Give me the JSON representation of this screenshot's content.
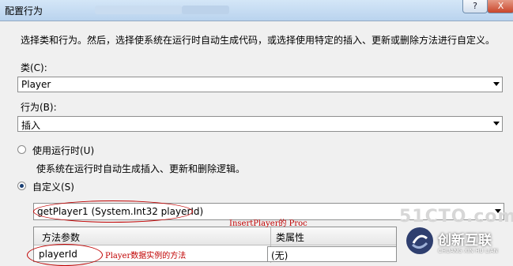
{
  "window": {
    "title": "配置行为",
    "minimize_label": "?",
    "close_label": "X"
  },
  "description": "选择类和行为。然后，选择使系统在运行时自动生成代码，或选择使用特定的插入、更新或删除方法进行自定义。",
  "class_field": {
    "label": "类(C):",
    "value": "Player"
  },
  "behavior_field": {
    "label": "行为(B):",
    "value": "插入"
  },
  "runtime_option": {
    "label": "使用运行时(U)",
    "description": "使系统在运行时自动生成插入、更新和删除逻辑。",
    "checked": false
  },
  "custom_option": {
    "label": "自定义(S)",
    "checked": true
  },
  "method_field": {
    "value": "getPlayer1 (System.Int32 playerId)"
  },
  "params_grid": {
    "columns": [
      "方法参数",
      "类属性"
    ],
    "rows": [
      {
        "param": "playerId",
        "property": "(无)"
      }
    ]
  },
  "annotations": {
    "insert_proc": "InsertPlayer的 Proc",
    "instance_method": "Player数据实例的方法"
  },
  "watermark": {
    "site": "51CTO.com",
    "logo_text": "创新互联",
    "logo_sub": "CHUANG XIN HU LIAN"
  },
  "colors": {
    "annotation": "#c00000",
    "titlebar": "#b9d3ee",
    "radio_selected": "#1a3f73"
  }
}
